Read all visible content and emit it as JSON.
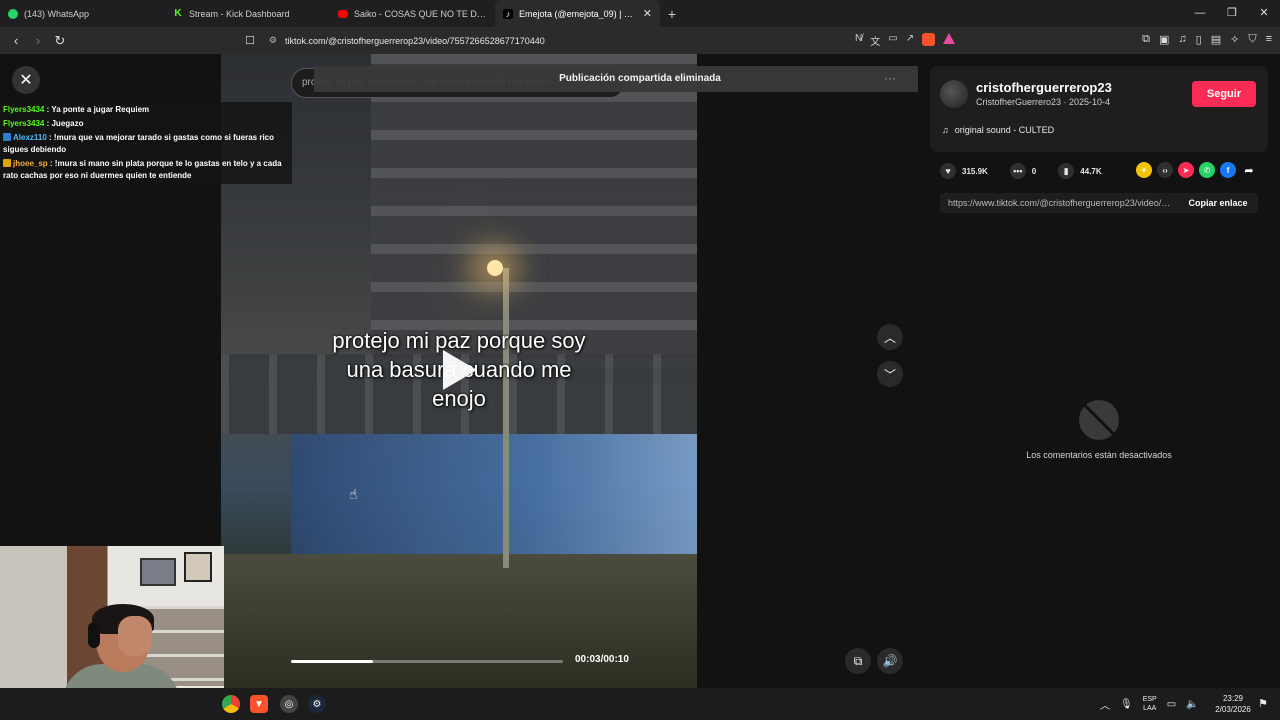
{
  "browser": {
    "tabs": [
      {
        "favicon": "whatsapp-icon",
        "title": "(143) WhatsApp"
      },
      {
        "favicon": "kick-icon",
        "title": "Stream - Kick Dashboard"
      },
      {
        "favicon": "youtube-icon",
        "title": "Saiko - COSAS QUE NO TE DIJE (Offi"
      },
      {
        "favicon": "tiktok-icon",
        "title": "Emejota (@emejota_09) | TikTok"
      }
    ],
    "url": "tiktok.com/@cristofherguerrerop23/video/7557266528677170440"
  },
  "page": {
    "search_text": "protejo mi paz porque soy una basura cuando me enojo",
    "toast": "Publicación compartida eliminada",
    "more_label": "···"
  },
  "video": {
    "caption_line1": "protejo mi paz porque soy",
    "caption_line2": "una basura cuando me",
    "caption_line3": "enojo",
    "time": "00:03/00:10",
    "progress": 0.3
  },
  "chat": [
    {
      "user": "Flyers3434",
      "text": "Ya ponte a jugar Requiem",
      "color": "green",
      "badge": ""
    },
    {
      "user": "Flyers3434",
      "text": "Juegazo",
      "color": "green",
      "badge": ""
    },
    {
      "user": "Alexz110",
      "text": "!mura que va mejorar tarado si gastas como si fueras rico sigues debiendo",
      "color": "blue",
      "badge": "#2e7dd1"
    },
    {
      "user": "jhoee_sp",
      "text": "!mura si mano sin plata porque te lo gastas en telo y a cada rato cachas por eso ni duermes quien te entiende",
      "color": "gold",
      "badge": "#e0a400"
    }
  ],
  "author": {
    "username": "cristofherguerrerop23",
    "subtitle": "CristofherGuerrero23 · 2025-10-4",
    "follow_label": "Seguir",
    "music": "original sound - CULTED"
  },
  "stats": {
    "likes": "315.9K",
    "comments": "0",
    "saves": "44.7K"
  },
  "share": {
    "link": "https://www.tiktok.com/@cristofherguerrerop23/video/7557266528677170440",
    "copy_label": "Copiar enlace"
  },
  "comments_disabled": "Los comentarios están desactivados",
  "taskbar": {
    "lang_line1": "ESP",
    "lang_line2": "LAA",
    "time": "23:29",
    "date": "2/03/2026"
  },
  "colors": {
    "accent": "#fe2c55",
    "kick_green": "#53fc18"
  }
}
